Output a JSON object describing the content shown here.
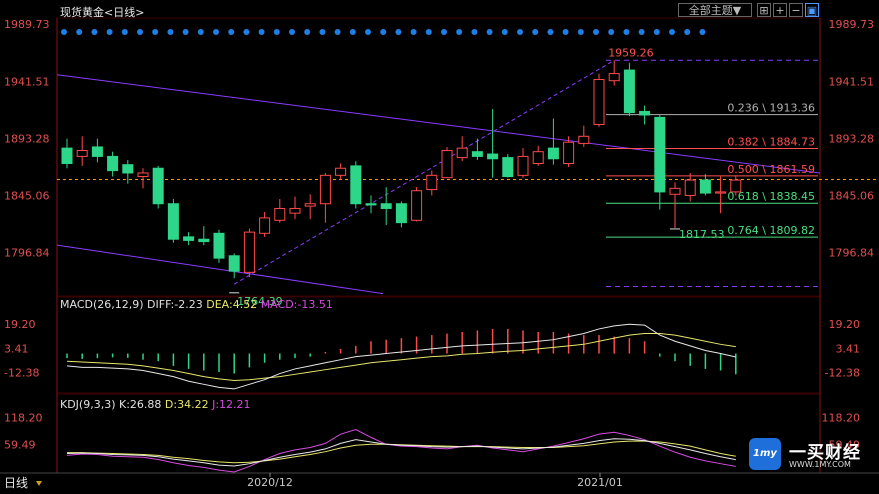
{
  "header": {
    "instrument": "现货黄金",
    "period": "<日线>",
    "theme_button": "全部主题▼",
    "tool_icons": [
      "fullscreen-icon",
      "zoom-in-icon",
      "zoom-out-icon",
      "window-icon"
    ]
  },
  "colors": {
    "up": "#ff4a4a",
    "down": "#2ed68a",
    "fib_red": "#ff5050",
    "fib_green": "#4ade80",
    "fib_gray": "#b0b0b0",
    "channel": "#8a3cff",
    "ref_line": "#ff9900",
    "marker_dot": "#1e7fe6",
    "diff_line": "#e8e8e8",
    "dea_line": "#e8e66a",
    "kdj_j": "#d64ce0"
  },
  "price_axis": {
    "labels": [
      "1989.73",
      "1941.51",
      "1893.28",
      "1845.06",
      "1796.84"
    ]
  },
  "macd_axis": {
    "labels": [
      "19.20",
      "3.41",
      "-12.38"
    ]
  },
  "kdj_axis": {
    "labels": [
      "118.20",
      "59.49"
    ]
  },
  "x_axis": {
    "labels": [
      "2020/12",
      "2021/01"
    ],
    "bottom_left": "日线"
  },
  "annotations": {
    "high": "1959.26",
    "low": "1764.39",
    "recent_low": "1817.53"
  },
  "fib_levels": [
    {
      "label": "0.236 \\ 1913.36",
      "value": 1913.36,
      "color": "gray"
    },
    {
      "label": "0.382 \\ 1884.73",
      "value": 1884.73,
      "color": "red"
    },
    {
      "label": "0.500 \\ 1861.59",
      "value": 1861.59,
      "color": "red"
    },
    {
      "label": "0.618 \\ 1838.45",
      "value": 1838.45,
      "color": "green"
    },
    {
      "label": "0.764 \\ 1809.82",
      "value": 1809.82,
      "color": "green"
    }
  ],
  "macd_header": {
    "name": "MACD(26,12,9)",
    "diff": "DIFF:-2.23",
    "dea": "DEA:4.52",
    "macd": "MACD:-13.51"
  },
  "kdj_header": {
    "name": "KDJ(9,3,3)",
    "k": "K:26.88",
    "d": "D:34.22",
    "j": "J:12.21"
  },
  "logo": {
    "name": "一买财经",
    "url": "WWW.1MY.COM",
    "mark": "1my"
  },
  "chart_data": {
    "type": "candlestick",
    "price_range": [
      1760,
      1995
    ],
    "candles": [
      {
        "o": 1885,
        "c": 1872,
        "h": 1893,
        "l": 1868
      },
      {
        "o": 1878,
        "c": 1883,
        "h": 1895,
        "l": 1870
      },
      {
        "o": 1886,
        "c": 1878,
        "h": 1893,
        "l": 1873
      },
      {
        "o": 1878,
        "c": 1866,
        "h": 1882,
        "l": 1861
      },
      {
        "o": 1871,
        "c": 1864,
        "h": 1875,
        "l": 1855
      },
      {
        "o": 1861,
        "c": 1864,
        "h": 1868,
        "l": 1851
      },
      {
        "o": 1868,
        "c": 1838,
        "h": 1870,
        "l": 1834
      },
      {
        "o": 1838,
        "c": 1808,
        "h": 1842,
        "l": 1805
      },
      {
        "o": 1810,
        "c": 1807,
        "h": 1814,
        "l": 1803
      },
      {
        "o": 1808,
        "c": 1806,
        "h": 1819,
        "l": 1803
      },
      {
        "o": 1813,
        "c": 1792,
        "h": 1816,
        "l": 1788
      },
      {
        "o": 1794,
        "c": 1781,
        "h": 1796,
        "l": 1775
      },
      {
        "o": 1780,
        "c": 1814,
        "h": 1817,
        "l": 1776
      },
      {
        "o": 1813,
        "c": 1826,
        "h": 1831,
        "l": 1810
      },
      {
        "o": 1824,
        "c": 1834,
        "h": 1842,
        "l": 1822
      },
      {
        "o": 1830,
        "c": 1834,
        "h": 1844,
        "l": 1825
      },
      {
        "o": 1836,
        "c": 1838,
        "h": 1846,
        "l": 1825
      },
      {
        "o": 1838,
        "c": 1862,
        "h": 1864,
        "l": 1822
      },
      {
        "o": 1862,
        "c": 1868,
        "h": 1872,
        "l": 1858
      },
      {
        "o": 1870,
        "c": 1838,
        "h": 1874,
        "l": 1834
      },
      {
        "o": 1838,
        "c": 1837,
        "h": 1845,
        "l": 1830
      },
      {
        "o": 1838,
        "c": 1834,
        "h": 1852,
        "l": 1820
      },
      {
        "o": 1838,
        "c": 1822,
        "h": 1840,
        "l": 1818
      },
      {
        "o": 1824,
        "c": 1849,
        "h": 1852,
        "l": 1823
      },
      {
        "o": 1850,
        "c": 1862,
        "h": 1866,
        "l": 1845
      },
      {
        "o": 1860,
        "c": 1883,
        "h": 1886,
        "l": 1860
      },
      {
        "o": 1877,
        "c": 1885,
        "h": 1895,
        "l": 1874
      },
      {
        "o": 1882,
        "c": 1878,
        "h": 1893,
        "l": 1875
      },
      {
        "o": 1880,
        "c": 1876,
        "h": 1918,
        "l": 1860
      },
      {
        "o": 1877,
        "c": 1861,
        "h": 1880,
        "l": 1860
      },
      {
        "o": 1862,
        "c": 1878,
        "h": 1885,
        "l": 1860
      },
      {
        "o": 1872,
        "c": 1882,
        "h": 1887,
        "l": 1870
      },
      {
        "o": 1885,
        "c": 1876,
        "h": 1910,
        "l": 1871
      },
      {
        "o": 1872,
        "c": 1890,
        "h": 1895,
        "l": 1869
      },
      {
        "o": 1889,
        "c": 1895,
        "h": 1904,
        "l": 1886
      },
      {
        "o": 1905,
        "c": 1943,
        "h": 1948,
        "l": 1903
      },
      {
        "o": 1942,
        "c": 1948,
        "h": 1959.26,
        "l": 1938
      },
      {
        "o": 1951,
        "c": 1915,
        "h": 1957,
        "l": 1912
      },
      {
        "o": 1916,
        "c": 1913,
        "h": 1921,
        "l": 1905
      },
      {
        "o": 1911,
        "c": 1848,
        "h": 1913,
        "l": 1833
      },
      {
        "o": 1846,
        "c": 1851,
        "h": 1856,
        "l": 1817.53
      },
      {
        "o": 1845,
        "c": 1858,
        "h": 1864,
        "l": 1840
      },
      {
        "o": 1858,
        "c": 1847,
        "h": 1863,
        "l": 1845
      },
      {
        "o": 1847,
        "c": 1848,
        "h": 1861,
        "l": 1830
      },
      {
        "o": 1848,
        "c": 1858,
        "h": 1862,
        "l": 1845
      }
    ],
    "macd": {
      "range": [
        -25,
        27
      ],
      "hist": [
        -3,
        -3.5,
        -3,
        -2.5,
        -2.8,
        -4,
        -5,
        -8,
        -10,
        -11,
        -12,
        -13,
        -9,
        -6,
        -4,
        -3,
        -2,
        1,
        3,
        5,
        8,
        9,
        10,
        11,
        12,
        13,
        14,
        15,
        16,
        16,
        15,
        14,
        14,
        13,
        12,
        12,
        11,
        10,
        8,
        -2,
        -5,
        -8,
        -10,
        -11,
        -13.51
      ],
      "diff": [
        -8,
        -9,
        -9,
        -9.5,
        -10,
        -11,
        -13,
        -15,
        -18,
        -20,
        -22,
        -23,
        -20,
        -17,
        -13,
        -10,
        -8,
        -6,
        -4,
        -2,
        -1,
        0,
        1,
        2,
        3,
        4,
        5,
        5.5,
        6,
        6.5,
        7,
        8,
        9,
        11,
        13,
        16,
        18,
        19,
        18.5,
        12,
        8,
        5,
        2,
        0,
        -2.23
      ],
      "dea": [
        -5,
        -5.5,
        -6,
        -6.5,
        -7,
        -8,
        -9.5,
        -11,
        -13,
        -15,
        -16.5,
        -17.5,
        -17,
        -16,
        -15,
        -13.5,
        -12,
        -10.5,
        -9,
        -7.5,
        -6,
        -5,
        -4,
        -3,
        -2,
        -1.5,
        -0.5,
        0,
        0.8,
        1.5,
        2,
        3,
        4,
        5,
        6,
        8,
        10,
        12,
        13,
        13,
        12,
        10,
        8,
        6,
        4.52
      ]
    },
    "kdj": {
      "range": [
        0,
        130
      ],
      "k": [
        40,
        41,
        40,
        38,
        37,
        36,
        33,
        28,
        24,
        20,
        15,
        13,
        18,
        25,
        32,
        38,
        43,
        50,
        62,
        70,
        65,
        60,
        58,
        57,
        55,
        54,
        55,
        56,
        54,
        52,
        50,
        52,
        54,
        58,
        62,
        68,
        72,
        71,
        68,
        62,
        55,
        48,
        40,
        33,
        26.88
      ],
      "d": [
        42,
        42,
        41,
        40,
        39,
        38,
        36,
        32,
        29,
        25,
        22,
        20,
        21,
        24,
        28,
        33,
        38,
        44,
        52,
        58,
        60,
        60,
        59,
        58,
        57,
        56,
        55,
        55,
        55,
        54,
        53,
        53,
        53,
        55,
        57,
        61,
        65,
        67,
        67,
        65,
        61,
        56,
        48,
        40,
        34.22
      ],
      "j": [
        36,
        39,
        38,
        34,
        33,
        32,
        27,
        20,
        14,
        10,
        4,
        0,
        12,
        27,
        40,
        48,
        53,
        62,
        82,
        92,
        75,
        60,
        56,
        55,
        52,
        50,
        55,
        58,
        52,
        48,
        44,
        50,
        56,
        64,
        72,
        82,
        86,
        79,
        70,
        56,
        43,
        32,
        24,
        18,
        12.21
      ]
    }
  }
}
